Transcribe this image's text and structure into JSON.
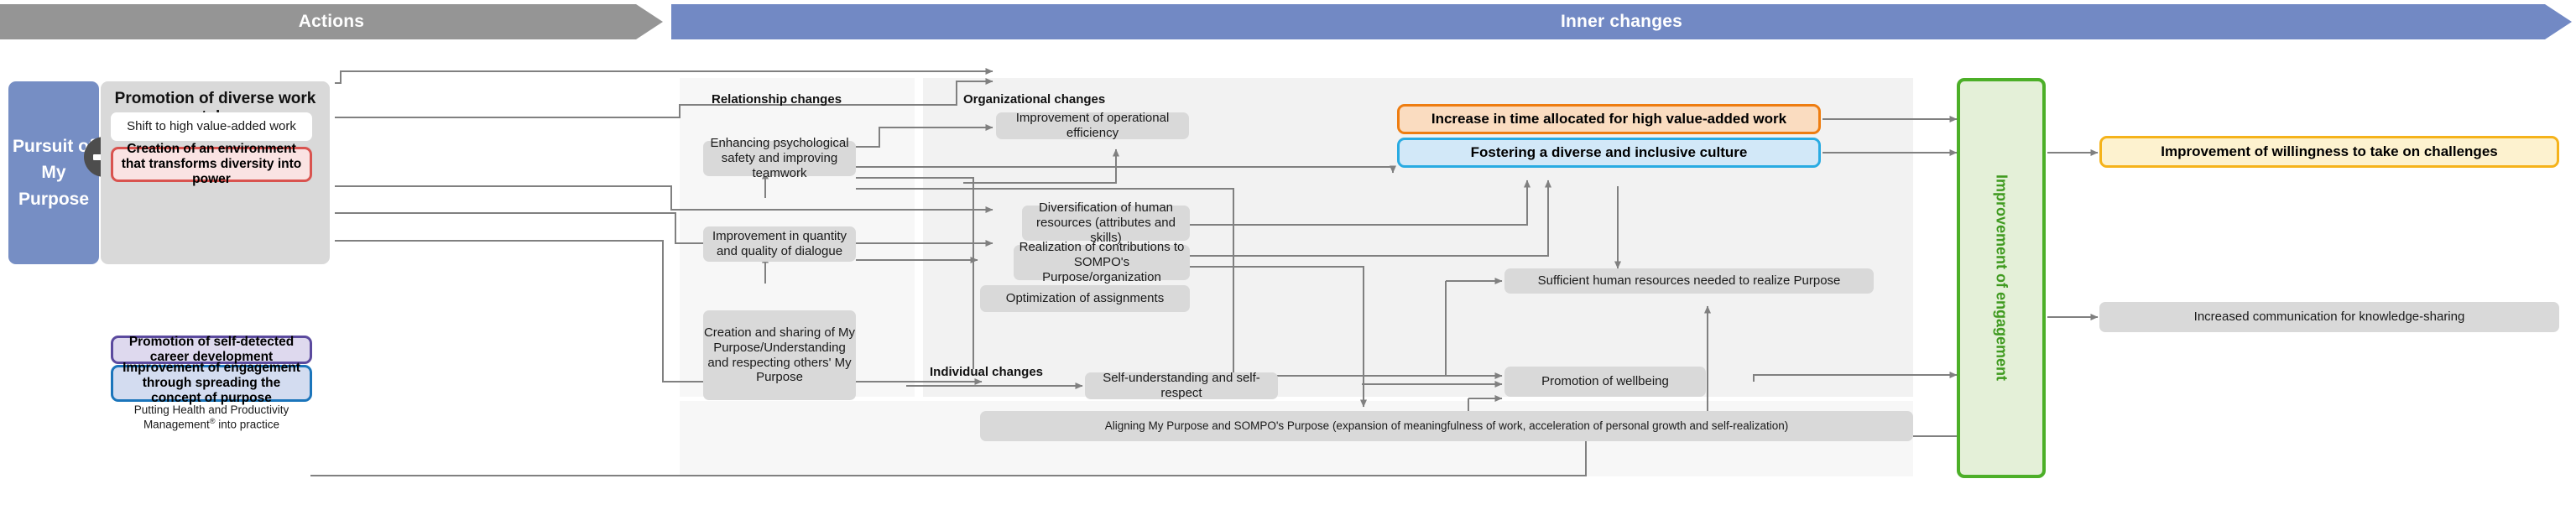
{
  "header": {
    "actions_label": "Actions",
    "inner_changes_label": "Inner changes"
  },
  "left": {
    "purpose_line1": "Pursuit of",
    "purpose_line2": "My Purpose",
    "plus_icon": "plus-icon"
  },
  "actions_panel": {
    "title": "Promotion of diverse work styles",
    "items": [
      {
        "label": "Shift to high value-added work",
        "style": "white"
      },
      {
        "label": "Creation of an environment that transforms diversity into power",
        "style": "red"
      },
      {
        "label": "Promotion of self-detected career development",
        "style": "purple"
      },
      {
        "label": "Improvement of engagement through spreading the concept of purpose",
        "style": "blue"
      },
      {
        "label": "Putting Health and Productivity Management® into practice",
        "style": "white"
      }
    ]
  },
  "columns": {
    "relationship": "Relationship changes",
    "organizational": "Organizational changes",
    "individual": "Individual changes"
  },
  "relationship_nodes": [
    {
      "label": "Enhancing psychological safety and improving teamwork"
    },
    {
      "label": "Improvement in quantity and quality of dialogue"
    },
    {
      "label": "Creation and sharing of My Purpose/Understanding and respecting others' My Purpose"
    }
  ],
  "organizational_nodes": [
    {
      "label": "Improvement of operational efficiency"
    },
    {
      "label": "Diversification of human resources (attributes and skills)"
    },
    {
      "label": "Realization of contributions to SOMPO's Purpose/organization"
    },
    {
      "label": "Optimization of assignments"
    }
  ],
  "individual_nodes": [
    {
      "label": "Self-understanding and self-respect"
    },
    {
      "label": "Aligning My Purpose and SOMPO's Purpose (expansion of meaningfulness of work, acceleration of personal growth and self-realization)"
    }
  ],
  "outcome_nodes": [
    {
      "label": "Increase in time allocated for high value-added work",
      "style": "orange"
    },
    {
      "label": "Fostering a diverse and inclusive culture",
      "style": "cyan"
    },
    {
      "label": "Sufficient human resources needed to realize Purpose",
      "style": "gray"
    },
    {
      "label": "Promotion of wellbeing",
      "style": "gray"
    }
  ],
  "engagement": {
    "label": "Improvement of engagement"
  },
  "final_nodes": [
    {
      "label": "Improvement of willingness to take on challenges",
      "style": "yellow"
    },
    {
      "label": "Increased communication for knowledge-sharing",
      "style": "gray"
    }
  ],
  "colors": {
    "actions_banner": "#959595",
    "inner_banner": "#7289c4",
    "purpose_card": "#768ec4",
    "panel_bg": "#d9d9d9",
    "node_gray": "#d9d9d9",
    "red": "#d9534f",
    "purple": "#5b4a9e",
    "blue": "#1b75bb",
    "orange": "#ee7d11",
    "cyan": "#29abe2",
    "green": "#4caf28",
    "yellow": "#f5b31b",
    "wire": "#808080"
  }
}
